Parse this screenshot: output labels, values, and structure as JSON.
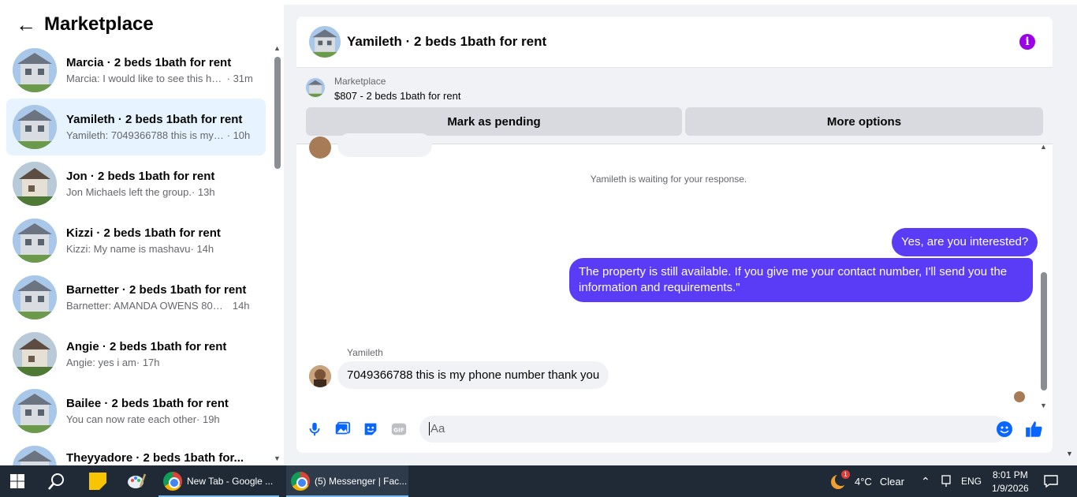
{
  "marketplace": {
    "title": "Marketplace",
    "conversations": [
      {
        "title": "Marcia · 2 beds 1bath for rent",
        "snippet": "Marcia: I would like to see this ho...",
        "time": "· 31m"
      },
      {
        "title": "Yamileth · 2 beds 1bath for rent",
        "snippet": "Yamileth: 7049366788 this is my p...",
        "time": "· 10h"
      },
      {
        "title": "Jon · 2 beds 1bath for rent",
        "snippet": "Jon Michaels left the group.",
        "time": "· 13h"
      },
      {
        "title": "Kizzi · 2 beds 1bath for rent",
        "snippet": "Kizzi: My name is mashavu",
        "time": "· 14h"
      },
      {
        "title": "Barnetter · 2 beds 1bath for rent",
        "snippet": "Barnetter: AMANDA OWENS 803-...",
        "time": "14h"
      },
      {
        "title": "Angie · 2 beds 1bath for rent",
        "snippet": "Angie: yes i am",
        "time": "· 17h"
      },
      {
        "title": "Bailee · 2 beds 1bath for rent",
        "snippet": "You can now rate each other",
        "time": "· 19h"
      },
      {
        "title": "Theyyadore · 2 beds 1bath for...",
        "snippet": "",
        "time": ""
      }
    ]
  },
  "chat": {
    "title": "Yamileth · 2 beds 1bath for rent",
    "listing_label": "Marketplace",
    "listing_price": "$807 - 2 beds 1bath for rent",
    "mark_pending": "Mark as pending",
    "more_options": "More options",
    "waiting": "Yamileth is waiting for your response.",
    "msg_out_1": "Yes, are you interested?",
    "msg_out_2": "The property is still available. If you give me your contact number, I'll send you the information and requirements.\"",
    "sender": "Yamileth",
    "msg_in_1": "7049366788 this is my phone number thank you",
    "input_placeholder": "Aa",
    "accent_color": "#5b3cf6",
    "icon_color": "#0866ff"
  },
  "taskbar": {
    "app1": "New Tab - Google ...",
    "app2": "(5) Messenger | Fac...",
    "weather_temp": "4°C",
    "weather_text": "Clear",
    "lang": "ENG",
    "time": "8:01 PM",
    "date": "1/9/2026",
    "weather_badge": "1"
  }
}
